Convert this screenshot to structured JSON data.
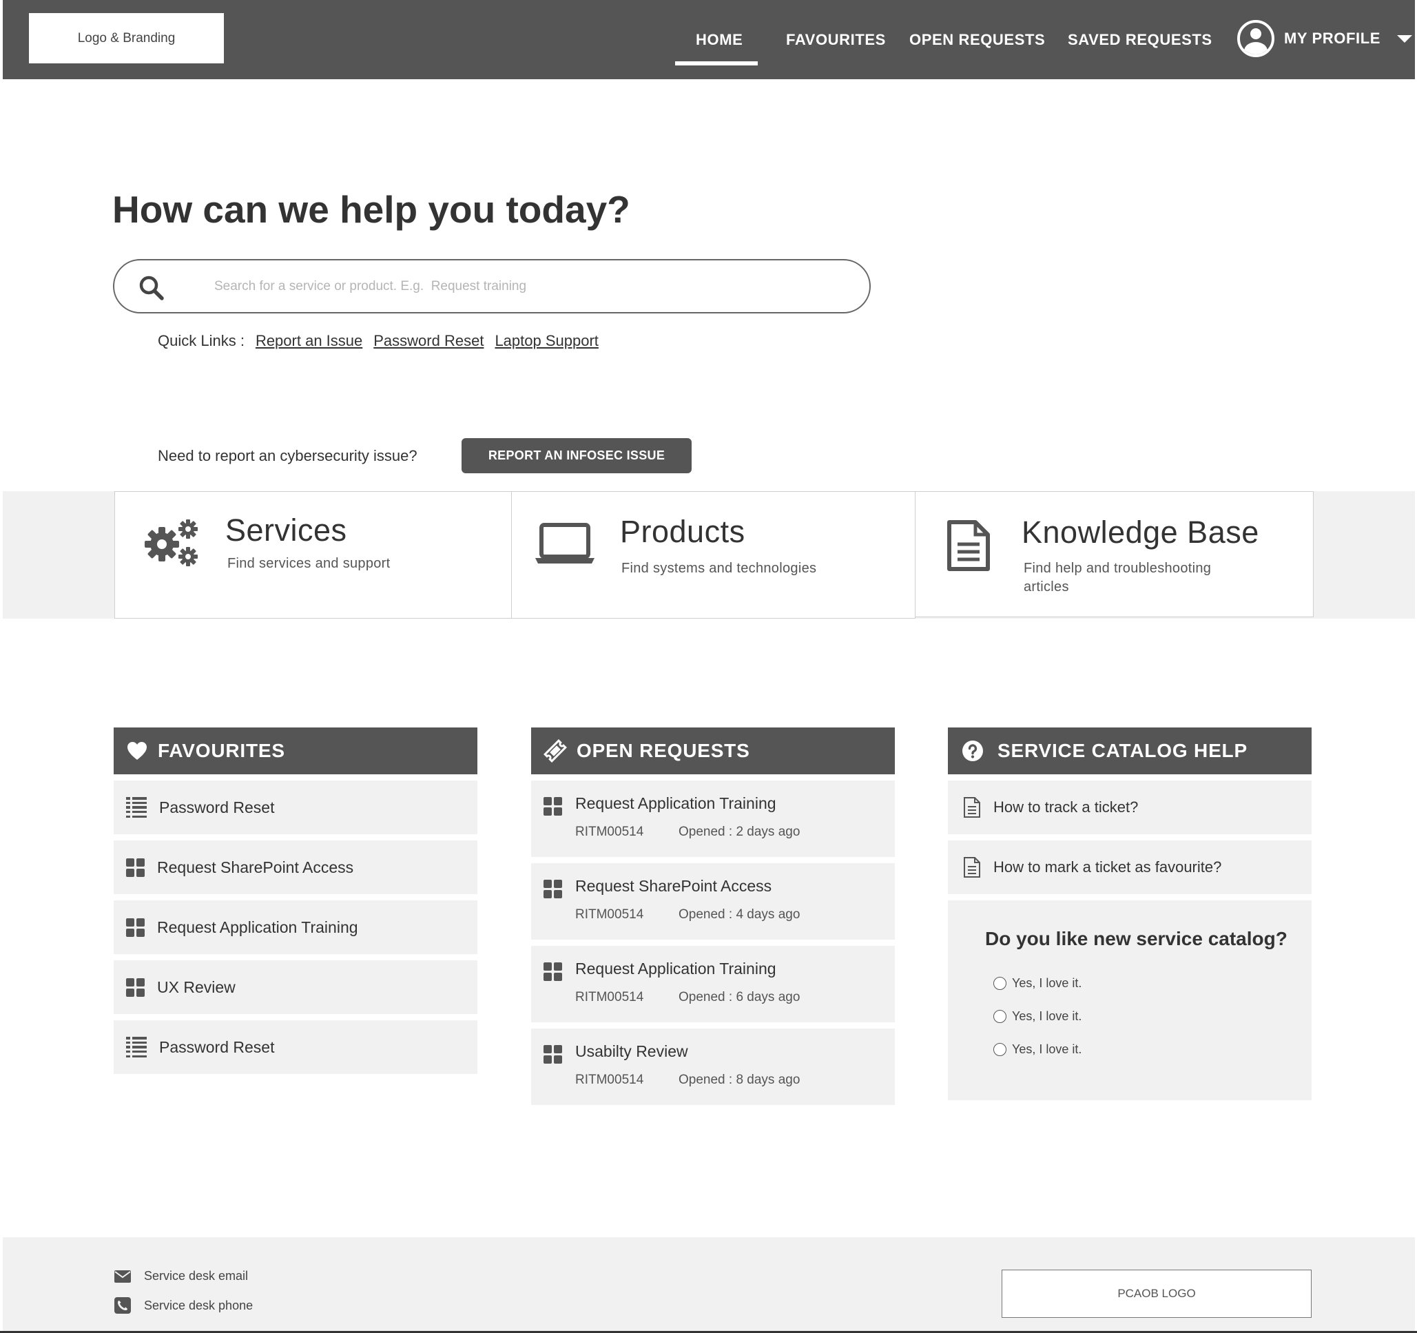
{
  "header": {
    "logo_text": "Logo & Branding",
    "nav": {
      "home": "HOME",
      "favourites": "FAVOURITES",
      "open_requests": "OPEN REQUESTS",
      "saved_requests": "SAVED REQUESTS"
    },
    "active_nav": "HOME",
    "profile_label": "MY PROFILE"
  },
  "hero": {
    "title": "How can we help you today?",
    "search_placeholder": "Search for a service or product. E.g.  Request training",
    "search_value": "",
    "quick_links_label": "Quick Links :",
    "quick_links": [
      "Report an Issue",
      "Password Reset",
      "Laptop Support"
    ],
    "cyber_prompt": "Need to report an cybersecurity issue?",
    "cyber_button": "REPORT AN INFOSEC ISSUE"
  },
  "categories": [
    {
      "title": "Services",
      "subtitle": "Find services and support",
      "icon": "gears-icon"
    },
    {
      "title": "Products",
      "subtitle": "Find systems and technologies",
      "icon": "laptop-icon"
    },
    {
      "title": "Knowledge Base",
      "subtitle": "Find help and troubleshooting articles",
      "icon": "document-icon"
    }
  ],
  "favourites": {
    "title": "FAVOURITES",
    "icon": "heart-icon",
    "items": [
      {
        "label": "Password Reset",
        "icon": "list-icon"
      },
      {
        "label": "Request SharePoint Access",
        "icon": "grid-icon"
      },
      {
        "label": "Request Application Training",
        "icon": "grid-icon"
      },
      {
        "label": "UX Review",
        "icon": "grid-icon"
      },
      {
        "label": "Password Reset",
        "icon": "list-icon"
      }
    ]
  },
  "open_requests": {
    "title": "OPEN REQUESTS",
    "icon": "ticket-icon",
    "items": [
      {
        "title": "Request Application Training",
        "number": "RITM00514",
        "opened": "Opened :  2 days ago"
      },
      {
        "title": "Request SharePoint Access",
        "number": "RITM00514",
        "opened": "Opened :  4 days ago"
      },
      {
        "title": "Request Application Training",
        "number": "RITM00514",
        "opened": "Opened :  6 days ago"
      },
      {
        "title": "Usabilty Review",
        "number": "RITM00514",
        "opened": "Opened :  8 days ago"
      }
    ]
  },
  "help": {
    "title": "SERVICE CATALOG HELP",
    "icon": "question-circle-icon",
    "items": [
      "How to track a ticket?",
      "How to mark a ticket as favourite?"
    ],
    "survey_question": "Do you like new service catalog?",
    "survey_options": [
      "Yes, I love it.",
      "Yes, I love it.",
      "Yes, I love it."
    ]
  },
  "footer": {
    "email_label": "Service desk email",
    "phone_label": "Service desk phone",
    "logo_text": "PCAOB LOGO"
  },
  "colors": {
    "header_bg": "#555555",
    "panel_bg": "#f1f1f1",
    "button_bg": "#555555"
  }
}
